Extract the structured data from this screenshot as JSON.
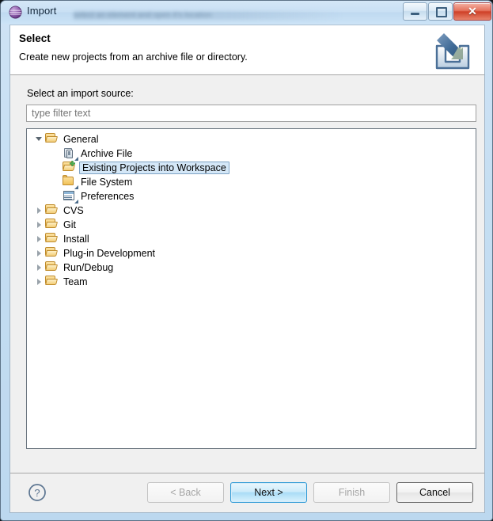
{
  "window": {
    "title": "Import",
    "app_icon": "eclipse-sphere-icon",
    "title_ghost": "select an element and open it's location",
    "controls": {
      "minimize": "minimize-button",
      "maximize": "maximize-button",
      "close": "close-button",
      "close_glyph": "✕"
    }
  },
  "header": {
    "title": "Select",
    "description": "Create new projects from an archive file or directory.",
    "banner_icon": "import-arrow-tray-icon"
  },
  "body": {
    "source_label": "Select an import source:",
    "filter": {
      "value": "",
      "placeholder": "type filter text"
    },
    "tree": [
      {
        "label": "General",
        "icon": "folder-open-icon",
        "level": 0,
        "state": "expanded",
        "selected": false
      },
      {
        "label": "Archive File",
        "icon": "archive-file-icon",
        "level": 1,
        "state": "leaf",
        "selected": false
      },
      {
        "label": "Existing Projects into Workspace",
        "icon": "import-project-icon",
        "level": 1,
        "state": "leaf",
        "selected": true
      },
      {
        "label": "File System",
        "icon": "folder-closed-icon",
        "level": 1,
        "state": "leaf",
        "selected": false
      },
      {
        "label": "Preferences",
        "icon": "preferences-icon",
        "level": 1,
        "state": "leaf",
        "selected": false
      },
      {
        "label": "CVS",
        "icon": "folder-open-icon",
        "level": 0,
        "state": "collapsed",
        "selected": false
      },
      {
        "label": "Git",
        "icon": "folder-open-icon",
        "level": 0,
        "state": "collapsed",
        "selected": false
      },
      {
        "label": "Install",
        "icon": "folder-open-icon",
        "level": 0,
        "state": "collapsed",
        "selected": false
      },
      {
        "label": "Plug-in Development",
        "icon": "folder-open-icon",
        "level": 0,
        "state": "collapsed",
        "selected": false
      },
      {
        "label": "Run/Debug",
        "icon": "folder-open-icon",
        "level": 0,
        "state": "collapsed",
        "selected": false
      },
      {
        "label": "Team",
        "icon": "folder-open-icon",
        "level": 0,
        "state": "collapsed",
        "selected": false
      }
    ]
  },
  "footer": {
    "help_icon": "help-question-icon",
    "buttons": [
      {
        "label": "< Back",
        "state": "disabled"
      },
      {
        "label": "Next >",
        "state": "default"
      },
      {
        "label": "Finish",
        "state": "disabled"
      },
      {
        "label": "Cancel",
        "state": "normal"
      }
    ]
  },
  "colors": {
    "selection_bg": "#d4e7f7",
    "selection_border": "#7da2c4",
    "default_button_border": "#2f9ad6",
    "close_button": "#cf4027",
    "titlebar": "#c9e0f4"
  }
}
